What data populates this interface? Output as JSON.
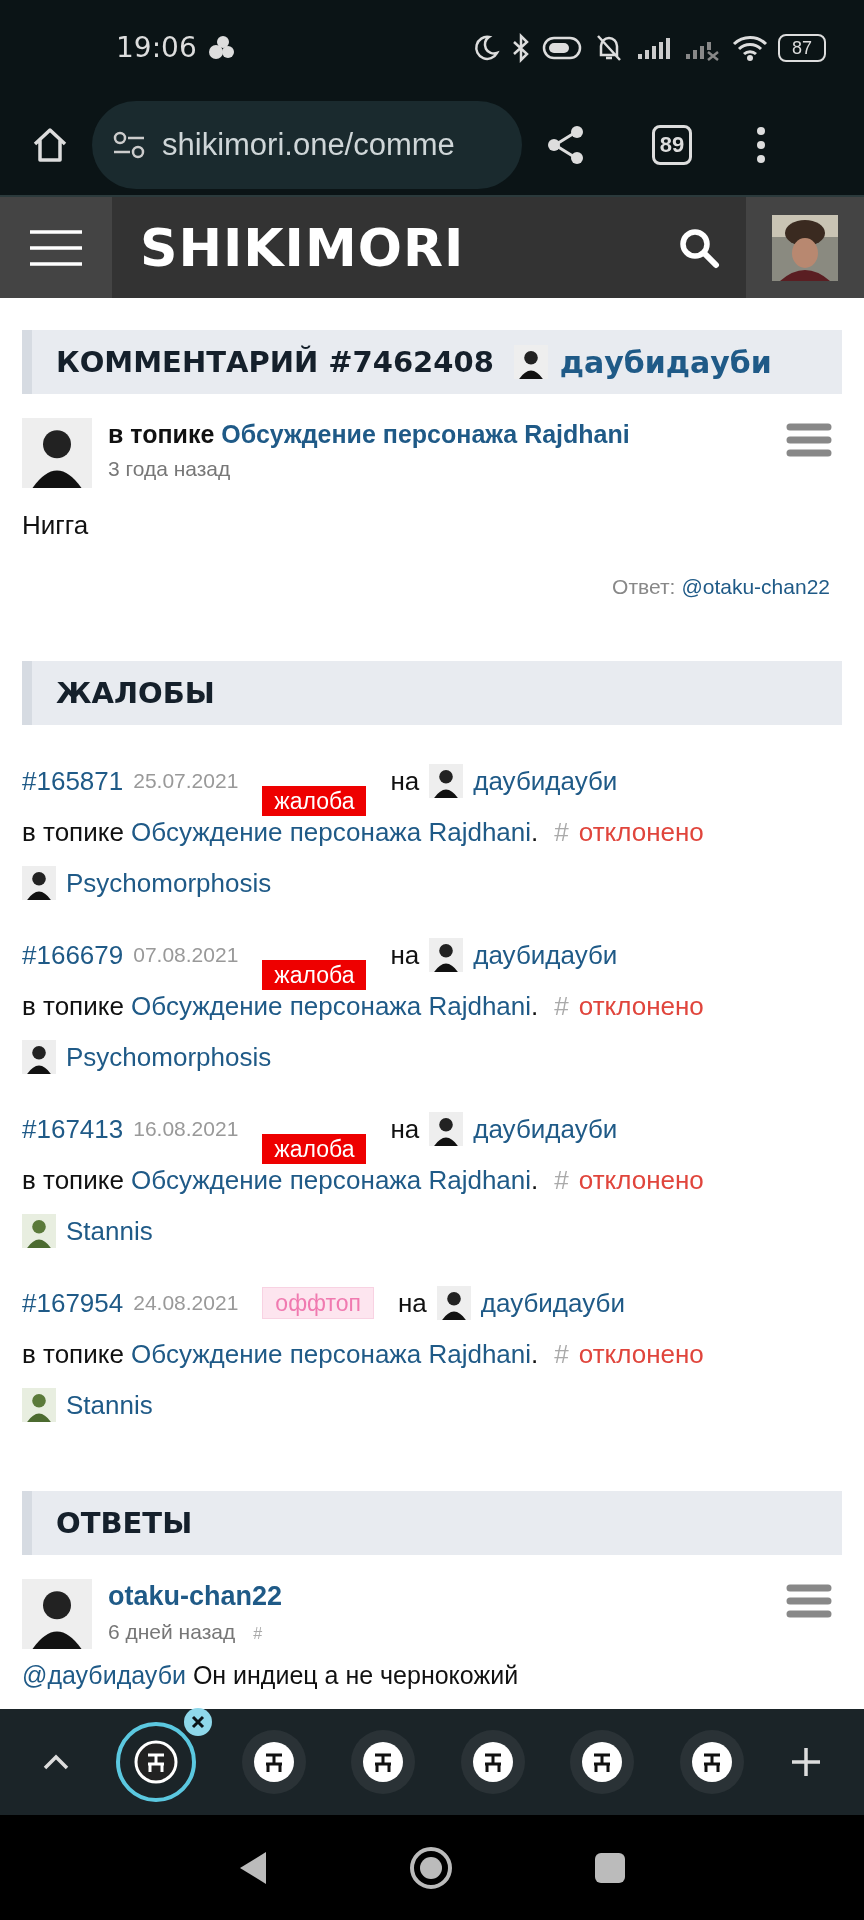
{
  "status_bar": {
    "time": "19:06",
    "battery": "87"
  },
  "browser": {
    "url": "shikimori.one/comme",
    "tab_count": "89"
  },
  "site_header": {
    "logo": "SHIKIMORI"
  },
  "comment": {
    "title": "КОММЕНТАРИЙ #7462408",
    "author": "даубидауби",
    "prefix": "в топике",
    "topic": "Обсуждение персонажа Rajdhani",
    "time": "3 года назад",
    "body": "Нигга",
    "reply_label": "Ответ:",
    "reply_link": "@otaku-chan22"
  },
  "complaints": {
    "title": "ЖАЛОБЫ",
    "items": [
      {
        "id": "#165871",
        "date": "25.07.2021",
        "kind": "complaint",
        "tag": "жалоба",
        "on": "на",
        "user": "даубидауби",
        "prefix": "в топике",
        "topic": "Обсуждение персонажа Rajdhani",
        "end": ".",
        "hash": "#",
        "status": "отклонено",
        "reporter": "Psychomorphosis"
      },
      {
        "id": "#166679",
        "date": "07.08.2021",
        "kind": "complaint",
        "tag": "жалоба",
        "on": "на",
        "user": "даубидауби",
        "prefix": "в топике",
        "topic": "Обсуждение персонажа Rajdhani",
        "end": ".",
        "hash": "#",
        "status": "отклонено",
        "reporter": "Psychomorphosis"
      },
      {
        "id": "#167413",
        "date": "16.08.2021",
        "kind": "complaint",
        "tag": "жалоба",
        "on": "на",
        "user": "даубидауби",
        "prefix": "в топике",
        "topic": "Обсуждение персонажа Rajdhani",
        "end": ".",
        "hash": "#",
        "status": "отклонено",
        "reporter": "Stannis"
      },
      {
        "id": "#167954",
        "date": "24.08.2021",
        "kind": "offtopic",
        "tag": "оффтоп",
        "on": "на",
        "user": "даубидауби",
        "prefix": "в топике",
        "topic": "Обсуждение персонажа Rajdhani",
        "end": ".",
        "hash": "#",
        "status": "отклонено",
        "reporter": "Stannis"
      }
    ]
  },
  "replies": {
    "title": "ОТВЕТЫ",
    "items": [
      {
        "user": "otaku-chan22",
        "time": "6 дней назад",
        "hash": "#",
        "mention": "@даубидауби",
        "text": "Он индиец а не чернокожий"
      }
    ]
  },
  "tab_bar": {
    "tabs": [
      {
        "selected": true
      },
      {
        "selected": false
      },
      {
        "selected": false
      },
      {
        "selected": false
      },
      {
        "selected": false
      },
      {
        "selected": false
      }
    ]
  }
}
